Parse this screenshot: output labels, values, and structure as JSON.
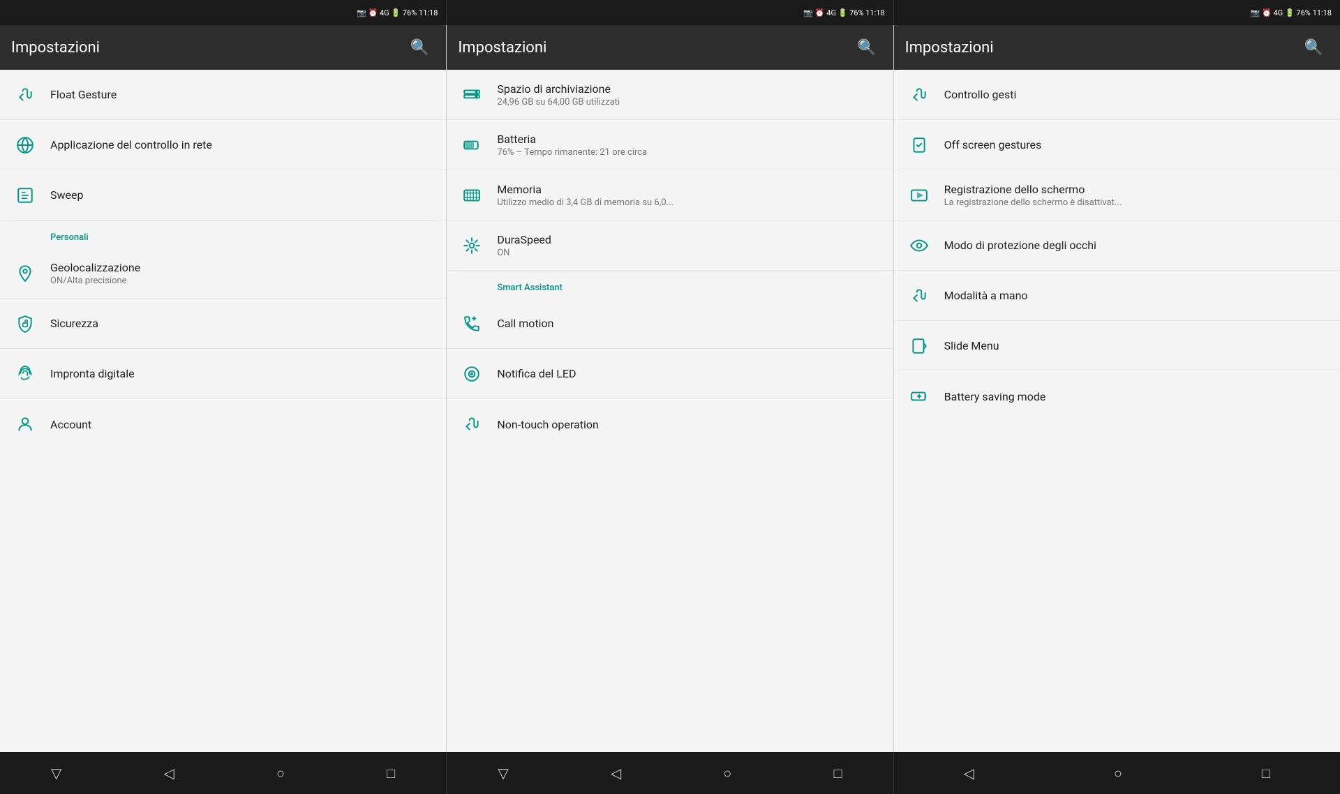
{
  "statusBar": {
    "segments": [
      {
        "icons": "📱 ⏰ 4G▲ 🔋",
        "battery": "76%",
        "time": "11:18"
      },
      {
        "icons": "📱 ⏰ 4G▲ 🔋",
        "battery": "76%",
        "time": "11:18"
      },
      {
        "icons": "📱 ⏰ 4G▲ 🔋",
        "battery": "76%",
        "time": "11:18"
      }
    ]
  },
  "panels": [
    {
      "id": "panel1",
      "appBar": {
        "title": "Impostazioni",
        "searchLabel": "🔍"
      },
      "items": [
        {
          "icon": "gesture",
          "title": "Float Gesture",
          "subtitle": ""
        },
        {
          "icon": "network",
          "title": "Applicazione del controllo in rete",
          "subtitle": ""
        },
        {
          "icon": "sweep",
          "title": "Sweep",
          "subtitle": ""
        }
      ],
      "sections": [
        {
          "header": "Personali",
          "items": [
            {
              "icon": "location",
              "title": "Geolocalizzazione",
              "subtitle": "ON/Alta precisione"
            },
            {
              "icon": "security",
              "title": "Sicurezza",
              "subtitle": ""
            },
            {
              "icon": "fingerprint",
              "title": "Impronta digitale",
              "subtitle": ""
            },
            {
              "icon": "account",
              "title": "Account",
              "subtitle": ""
            }
          ]
        }
      ]
    },
    {
      "id": "panel2",
      "appBar": {
        "title": "Impostazioni",
        "searchLabel": "🔍"
      },
      "items": [
        {
          "icon": "storage",
          "title": "Spazio di archiviazione",
          "subtitle": "24,96 GB su 64,00 GB utilizzati"
        },
        {
          "icon": "battery",
          "title": "Batteria",
          "subtitle": "76% – Tempo rimanente: 21 ore circa"
        },
        {
          "icon": "memory",
          "title": "Memoria",
          "subtitle": "Utilizzo medio di 3,4 GB di memoria su 6,0..."
        },
        {
          "icon": "duraspeed",
          "title": "DuraSpeed",
          "subtitle": "ON"
        }
      ],
      "sections": [
        {
          "header": "Smart Assistant",
          "items": [
            {
              "icon": "callmotion",
              "title": "Call motion",
              "subtitle": ""
            },
            {
              "icon": "led",
              "title": "Notifica del LED",
              "subtitle": ""
            },
            {
              "icon": "notouch",
              "title": "Non-touch operation",
              "subtitle": ""
            }
          ]
        }
      ]
    },
    {
      "id": "panel3",
      "appBar": {
        "title": "Impostazioni",
        "searchLabel": "🔍"
      },
      "items": [
        {
          "icon": "gesture-ctrl",
          "title": "Controllo gesti",
          "subtitle": ""
        },
        {
          "icon": "offscreen",
          "title": "Off screen gestures",
          "subtitle": ""
        },
        {
          "icon": "screenrec",
          "title": "Registrazione dello schermo",
          "subtitle": "La registrazione dello schermo è disattivat..."
        },
        {
          "icon": "eyeprotect",
          "title": "Modo di protezione degli occhi",
          "subtitle": ""
        },
        {
          "icon": "onehand",
          "title": "Modalità a mano",
          "subtitle": ""
        },
        {
          "icon": "slidemenu",
          "title": "Slide Menu",
          "subtitle": ""
        },
        {
          "icon": "batterysave",
          "title": "Battery saving mode",
          "subtitle": ""
        }
      ]
    }
  ],
  "navBar": {
    "buttons": [
      "▽",
      "◁",
      "○",
      "□"
    ]
  }
}
